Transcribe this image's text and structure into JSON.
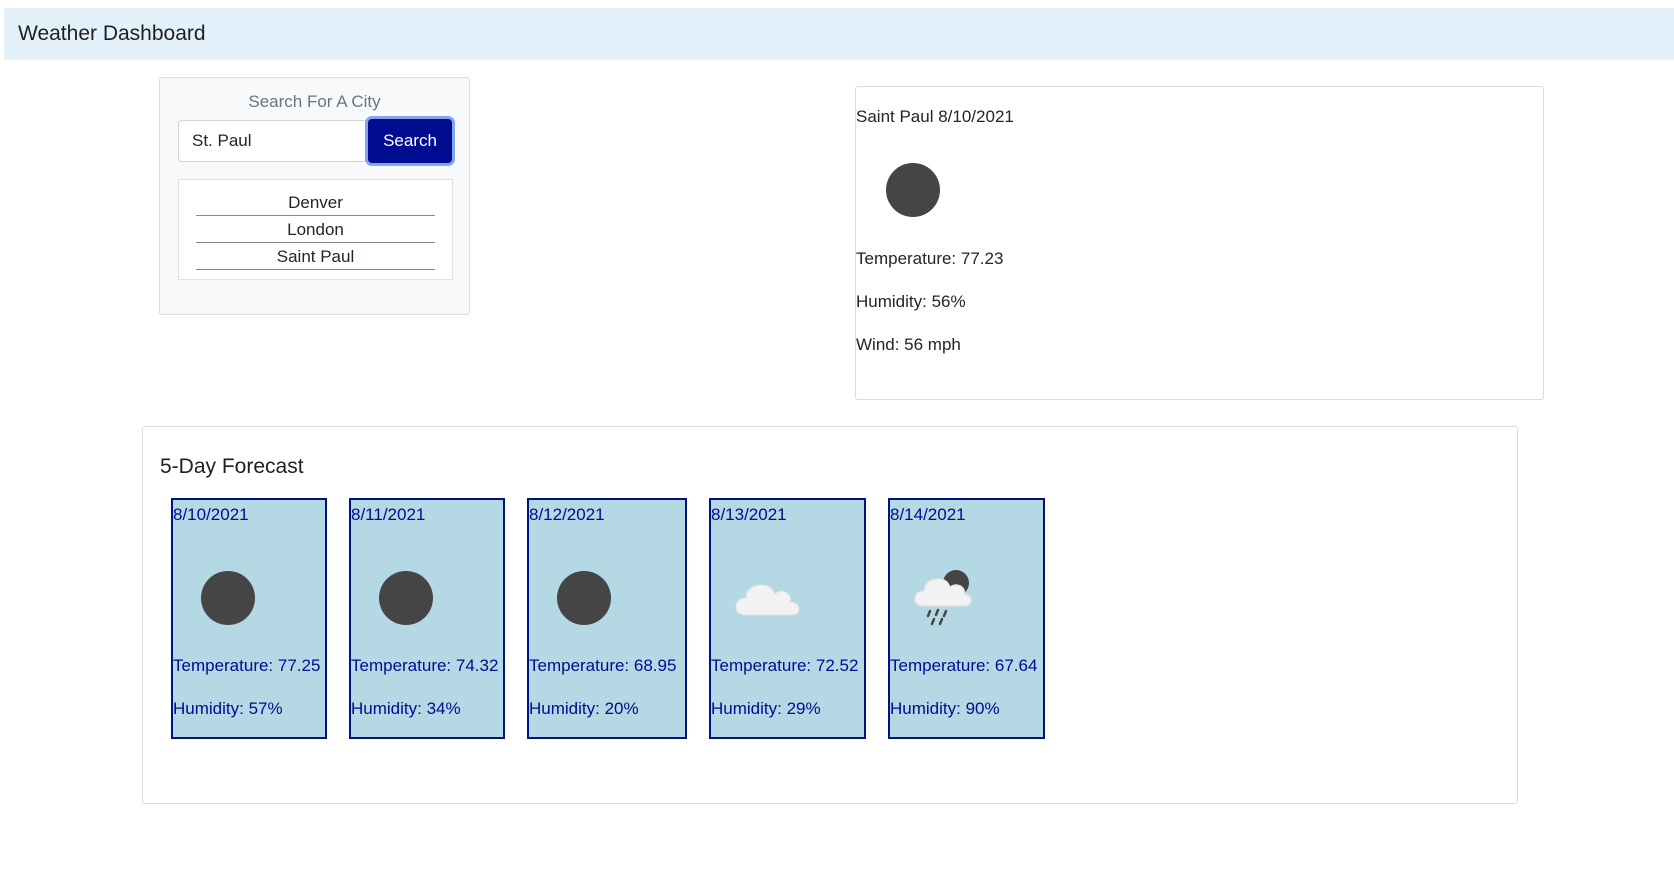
{
  "app": {
    "title": "Weather Dashboard"
  },
  "search": {
    "heading": "Search For A City",
    "input_value": "St. Paul",
    "button_label": "Search",
    "history": [
      "Denver",
      "London",
      "Saint Paul"
    ]
  },
  "current": {
    "city_date": "Saint Paul 8/10/2021",
    "icon": "clear-sky-icon",
    "temperature": "Temperature: 77.23",
    "humidity": "Humidity: 56%",
    "wind": "Wind: 56 mph"
  },
  "forecast": {
    "title": "5-Day Forecast",
    "days": [
      {
        "date": "8/10/2021",
        "icon": "clear-sky-icon",
        "temperature": "Temperature: 77.25",
        "humidity": "Humidity: 57%"
      },
      {
        "date": "8/11/2021",
        "icon": "clear-sky-icon",
        "temperature": "Temperature: 74.32",
        "humidity": "Humidity: 34%"
      },
      {
        "date": "8/12/2021",
        "icon": "clear-sky-icon",
        "temperature": "Temperature: 68.95",
        "humidity": "Humidity: 20%"
      },
      {
        "date": "8/13/2021",
        "icon": "cloud-icon",
        "temperature": "Temperature: 72.52",
        "humidity": "Humidity: 29%"
      },
      {
        "date": "8/14/2021",
        "icon": "rain-cloud-icon",
        "temperature": "Temperature: 67.64",
        "humidity": "Humidity: 90%"
      }
    ]
  },
  "colors": {
    "navbar_bg": "#e3f1fb",
    "button_bg": "#000c8f",
    "forecast_card_bg": "#b4d8e4",
    "forecast_text": "#000c8f",
    "icon_dark": "#454545"
  }
}
